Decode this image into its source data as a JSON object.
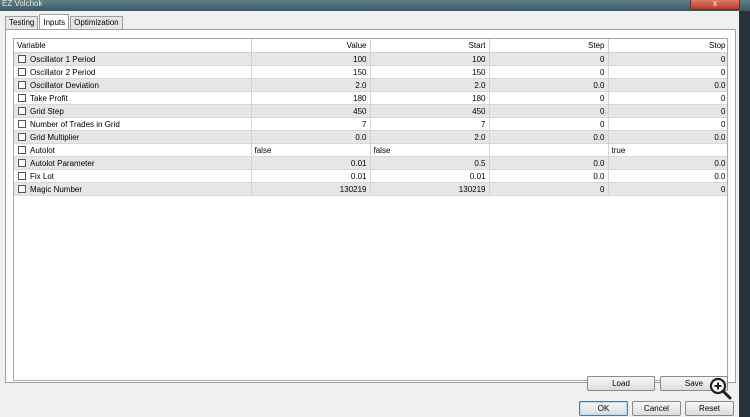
{
  "window": {
    "title": "EZ Volchok",
    "close_label": "x"
  },
  "tabs": [
    {
      "label": "Testing"
    },
    {
      "label": "Inputs"
    },
    {
      "label": "Optimization"
    }
  ],
  "columns": {
    "variable": "Variable",
    "value": "Value",
    "start": "Start",
    "step": "Step",
    "stop": "Stop"
  },
  "rows": [
    {
      "variable": "Oscillator 1 Period",
      "value": "100",
      "start": "100",
      "step": "0",
      "stop": "0"
    },
    {
      "variable": "Oscillator 2 Period",
      "value": "150",
      "start": "150",
      "step": "0",
      "stop": "0"
    },
    {
      "variable": "Oscillator Deviation",
      "value": "2.0",
      "start": "2.0",
      "step": "0.0",
      "stop": "0.0"
    },
    {
      "variable": "Take Profit",
      "value": "180",
      "start": "180",
      "step": "0",
      "stop": "0"
    },
    {
      "variable": "Grid Step",
      "value": "450",
      "start": "450",
      "step": "0",
      "stop": "0"
    },
    {
      "variable": "Number of Trades in Grid",
      "value": "7",
      "start": "7",
      "step": "0",
      "stop": "0"
    },
    {
      "variable": "Grid Multiplier",
      "value": "0.0",
      "start": "2.0",
      "step": "0.0",
      "stop": "0.0"
    },
    {
      "variable": "Autolot",
      "value": "false",
      "start": "false",
      "step": "",
      "stop": "true"
    },
    {
      "variable": "Autolot Parameter",
      "value": "0.01",
      "start": "0.5",
      "step": "0.0",
      "stop": "0.0"
    },
    {
      "variable": "Fix Lot",
      "value": "0.01",
      "start": "0.01",
      "step": "0.0",
      "stop": "0.0"
    },
    {
      "variable": "Magic Number",
      "value": "130219",
      "start": "130219",
      "step": "0",
      "stop": "0"
    }
  ],
  "buttons": {
    "load": "Load",
    "save": "Save",
    "ok": "OK",
    "cancel": "Cancel",
    "reset": "Reset"
  },
  "icons": {
    "zoom": "zoom-in-icon"
  }
}
